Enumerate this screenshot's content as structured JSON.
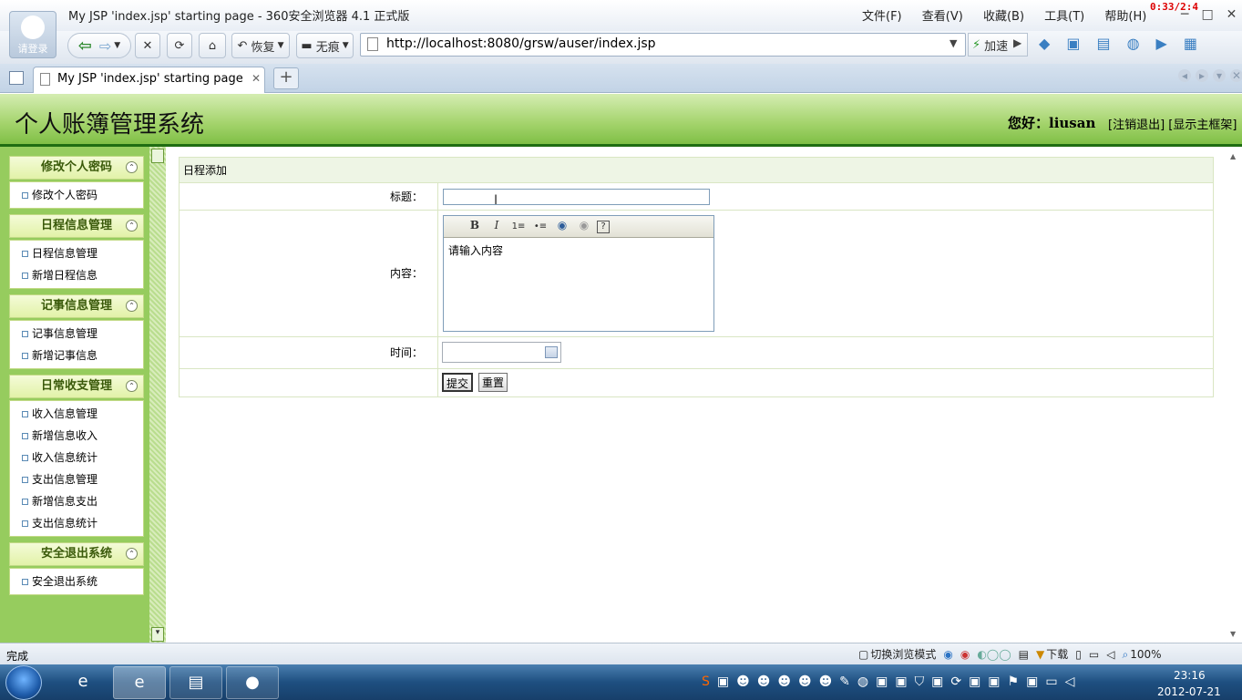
{
  "browser": {
    "window_title": "My JSP 'index.jsp' starting page - 360安全浏览器 4.1 正式版",
    "avatar_label": "请登录",
    "menu": [
      "文件(F)",
      "查看(V)",
      "收藏(B)",
      "工具(T)",
      "帮助(H)"
    ],
    "timer": "0:33/2:4",
    "back_label": "恢复",
    "incognito_label": "无痕",
    "address": "http://localhost:8080/grsw/auser/index.jsp",
    "speedup_label": "加速",
    "tab_title": "My JSP 'index.jsp' starting page",
    "newtab_label": "+"
  },
  "header": {
    "title": "个人账簿管理系统",
    "greeting": "您好：liusan",
    "logout_link": "[注销退出]",
    "frame_link": "[显示主框架]"
  },
  "sidebar": {
    "sections": [
      {
        "title": "修改个人密码",
        "items": [
          "修改个人密码"
        ]
      },
      {
        "title": "日程信息管理",
        "items": [
          "日程信息管理",
          "新增日程信息"
        ]
      },
      {
        "title": "记事信息管理",
        "items": [
          "记事信息管理",
          "新增记事信息"
        ]
      },
      {
        "title": "日常收支管理",
        "items": [
          "收入信息管理",
          "新增信息收入",
          "收入信息统计",
          "支出信息管理",
          "新增信息支出",
          "支出信息统计"
        ]
      },
      {
        "title": "安全退出系统",
        "items": [
          "安全退出系统"
        ]
      }
    ]
  },
  "form": {
    "heading": "日程添加",
    "title_label": "标题：",
    "title_value": "",
    "content_label": "内容：",
    "content_placeholder": "请输入内容",
    "editor_tools": [
      "B",
      "I",
      "1≡",
      "•≡",
      "◉",
      "◉",
      "?"
    ],
    "time_label": "时间：",
    "time_value": "",
    "submit_label": "提交",
    "reset_label": "重置"
  },
  "status": {
    "left": "完成",
    "mode_label": "切换浏览模式",
    "download_label": "下载",
    "zoom": "100%"
  },
  "taskbar": {
    "time": "23:16",
    "date": "2012-07-21"
  }
}
